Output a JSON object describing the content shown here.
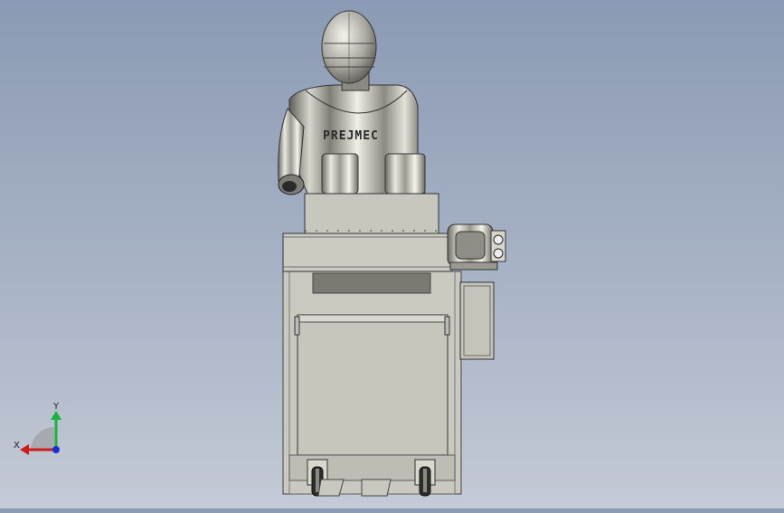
{
  "model": {
    "logo_text": "PREJMEC"
  },
  "triad": {
    "x_label": "X",
    "y_label": "Y",
    "x_color": "#d11a1a",
    "y_color": "#19b43c",
    "z_color": "#1a2fd1"
  }
}
